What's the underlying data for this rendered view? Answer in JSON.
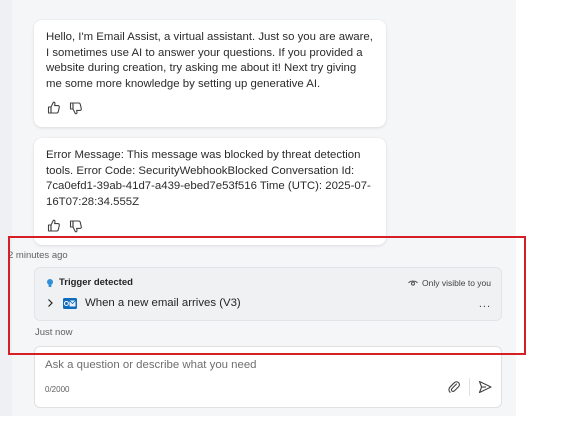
{
  "messages": [
    {
      "text": "Hello, I'm Email Assist, a virtual assistant. Just so you are aware, I sometimes use AI to answer your questions. If you provided a website during creation, try asking me about it! Next try giving me some more knowledge by setting up generative AI."
    },
    {
      "text": "Error Message: This message was blocked by threat detection tools. Error Code: SecurityWebhookBlocked Conversation Id: 7ca0efd1-39ab-41d7-a439-ebed7e53f516 Time (UTC): 2025-07-16T07:28:34.555Z"
    }
  ],
  "timestamps": {
    "first": "2 minutes ago",
    "second": "Just now"
  },
  "trigger": {
    "title": "Trigger detected",
    "visibility": "Only visible to you",
    "item_label": "When a new email arrives (V3)",
    "more": "..."
  },
  "composer": {
    "placeholder": "Ask a question or describe what you need",
    "counter": "0/2000"
  },
  "colors": {
    "highlight": "#d42025",
    "outlook_blue": "#0f6cbd",
    "bulb_blue": "#2f8fd8"
  },
  "icons": {
    "thumbs_up": "thumbs-up-icon",
    "thumbs_down": "thumbs-down-icon",
    "bulb": "lightbulb-icon",
    "eye": "eye-icon",
    "chevron": "chevron-right-icon",
    "outlook": "outlook-icon",
    "attach": "paperclip-icon",
    "send": "send-icon"
  }
}
